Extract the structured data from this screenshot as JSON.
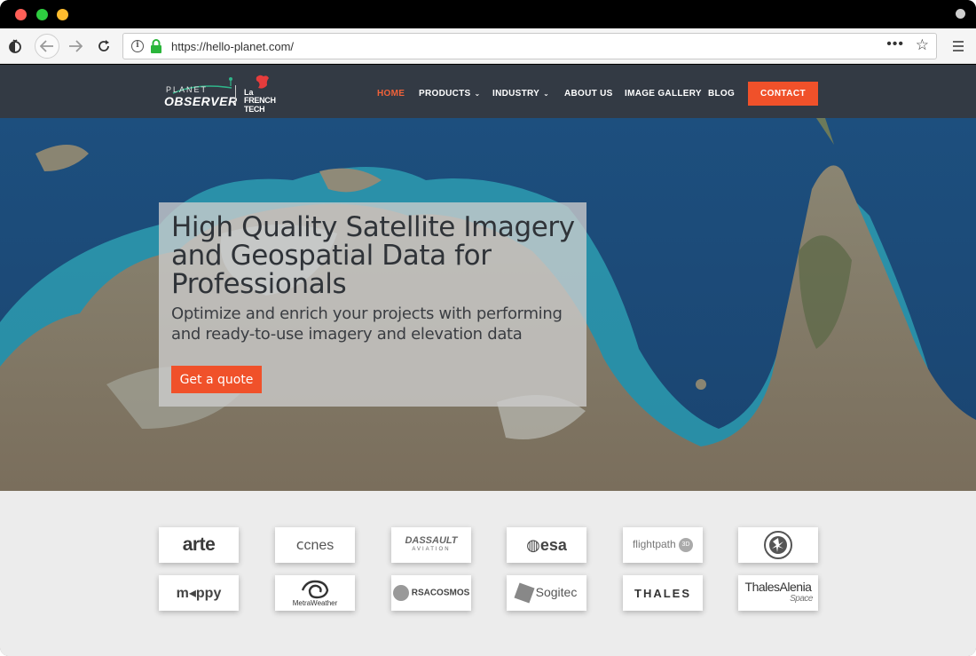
{
  "browser": {
    "url": "https://hello-planet.com/",
    "icons": [
      "privacy-icon",
      "back-arrow-icon",
      "forward-arrow-icon",
      "reload-icon",
      "info-icon",
      "lock-icon",
      "more-dots-icon",
      "bookmark-star-icon",
      "hamburger-menu-icon"
    ]
  },
  "header": {
    "logo": {
      "planet": "PLANET",
      "observer": "OBSERVER",
      "la": "La",
      "french_tech": "FRENCH TECH"
    },
    "nav": [
      {
        "label": "HOME",
        "active": true
      },
      {
        "label": "PRODUCTS",
        "dropdown": true
      },
      {
        "label": "INDUSTRY",
        "dropdown": true
      },
      {
        "label": "ABOUT US"
      },
      {
        "label": "IMAGE GALLERY"
      },
      {
        "label": "BLOG"
      }
    ],
    "contact_label": "CONTACT",
    "accent": "#f0512a"
  },
  "hero": {
    "title": "High Quality Satellite Imagery and Geospatial Data for Professionals",
    "subtitle": "Optimize and enrich your projects with performing and ready-to-use imagery and elevation data",
    "cta_label": "Get a quote"
  },
  "partners": {
    "row1": [
      "arte",
      "cnes",
      "DASSAULT",
      "esa",
      "flightpath",
      "hk-emblem"
    ],
    "row2": [
      "mappy",
      "MetraWeather",
      "RSACOSMOS",
      "Sogitec",
      "THALES",
      "ThalesAlenia"
    ],
    "labels": {
      "arte": "arte",
      "cnes": "cnes",
      "dassault": "DASSAULT",
      "dassault_sub": "AVIATION",
      "esa": "esa",
      "flightpath": "flightpath",
      "flightpath_badge": "3D",
      "mappy": "m◂ppy",
      "metra": "MetraWeather",
      "rsa": "RSACOSMOS",
      "sogitec": "Sogitec",
      "thales": "THALES",
      "ta": "ThalesAlenia",
      "ta_space": "Space"
    }
  }
}
